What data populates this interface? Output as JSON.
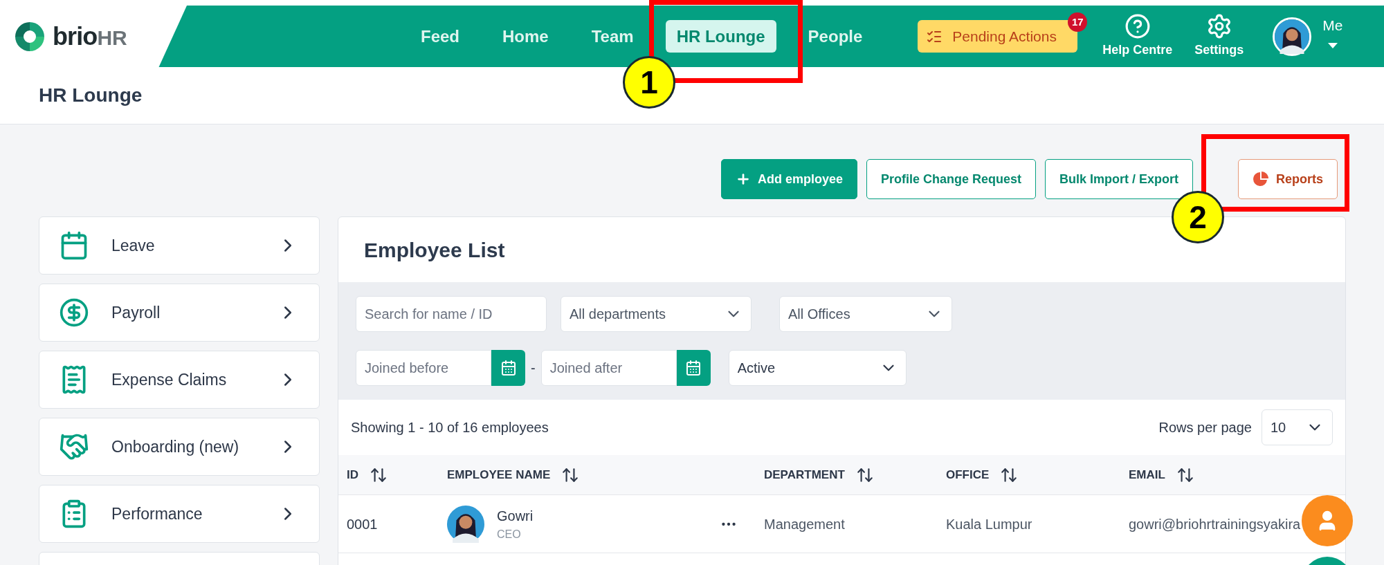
{
  "nav": {
    "logo": {
      "primary": "brio",
      "secondary": "HR"
    },
    "items": [
      {
        "label": "Feed",
        "selected": false
      },
      {
        "label": "Home",
        "selected": false
      },
      {
        "label": "Team",
        "selected": false
      },
      {
        "label": "HR Lounge",
        "selected": true
      },
      {
        "label": "People",
        "selected": false
      }
    ],
    "pending": {
      "label": "Pending Actions",
      "count": "17"
    },
    "help": "Help Centre",
    "settings": "Settings",
    "user": "Me"
  },
  "page_title": "HR Lounge",
  "actions": [
    {
      "kind": "primary",
      "label": "Add employee"
    },
    {
      "kind": "outline",
      "label": "Profile Change Request"
    },
    {
      "kind": "outline",
      "label": "Bulk Import / Export"
    },
    {
      "kind": "report",
      "label": "Reports"
    }
  ],
  "sidebar": [
    {
      "label": "Leave"
    },
    {
      "label": "Payroll"
    },
    {
      "label": "Expense Claims"
    },
    {
      "label": "Onboarding (new)"
    },
    {
      "label": "Performance"
    }
  ],
  "employee_list": {
    "title": "Employee List",
    "search": {
      "placeholder": "Search for name / ID"
    },
    "department": "All departments",
    "office": "All Offices",
    "joined_before": {
      "placeholder": "Joined before"
    },
    "joined_after": {
      "placeholder": "Joined after"
    },
    "separator": "-",
    "status": "Active",
    "summary": "Showing 1 - 10 of 16 employees",
    "rows_per_page": {
      "label": "Rows per page",
      "value": "10"
    },
    "columns": [
      "ID",
      "EMPLOYEE NAME",
      "DEPARTMENT",
      "OFFICE",
      "EMAIL"
    ],
    "rows": [
      {
        "id": "0001",
        "name": "Gowri",
        "title": "CEO",
        "department": "Management",
        "office": "Kuala Lumpur",
        "email": "gowri@briohrtrainingsyakira"
      }
    ]
  },
  "annotations": [
    {
      "label": "1"
    },
    {
      "label": "2"
    }
  ]
}
